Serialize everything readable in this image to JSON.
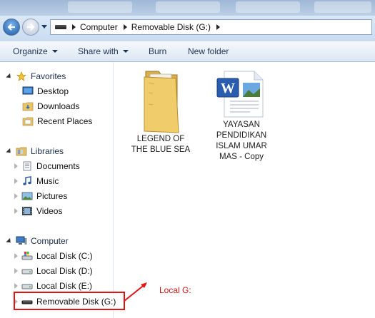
{
  "address": {
    "crumbs": [
      "Computer",
      "Removable Disk (G:)"
    ]
  },
  "toolbar": {
    "organize": "Organize",
    "share_with": "Share with",
    "burn": "Burn",
    "new_folder": "New folder"
  },
  "nav": {
    "favorites": {
      "label": "Favorites",
      "items": [
        "Desktop",
        "Downloads",
        "Recent Places"
      ]
    },
    "libraries": {
      "label": "Libraries",
      "items": [
        "Documents",
        "Music",
        "Pictures",
        "Videos"
      ]
    },
    "computer": {
      "label": "Computer",
      "items": [
        "Local Disk (C:)",
        "Local Disk (D:)",
        "Local Disk (E:)",
        "Removable Disk (G:)"
      ]
    }
  },
  "content": {
    "items": [
      {
        "type": "folder",
        "label": "LEGEND OF THE BLUE SEA",
        "icon": "folder-icon"
      },
      {
        "type": "word-document",
        "label": "YAYASAN PENDIDIKAN ISLAM UMAR MAS - Copy",
        "icon": "word-document-icon"
      }
    ]
  },
  "annotation": {
    "text": "Local G:",
    "color": "#d41414"
  }
}
